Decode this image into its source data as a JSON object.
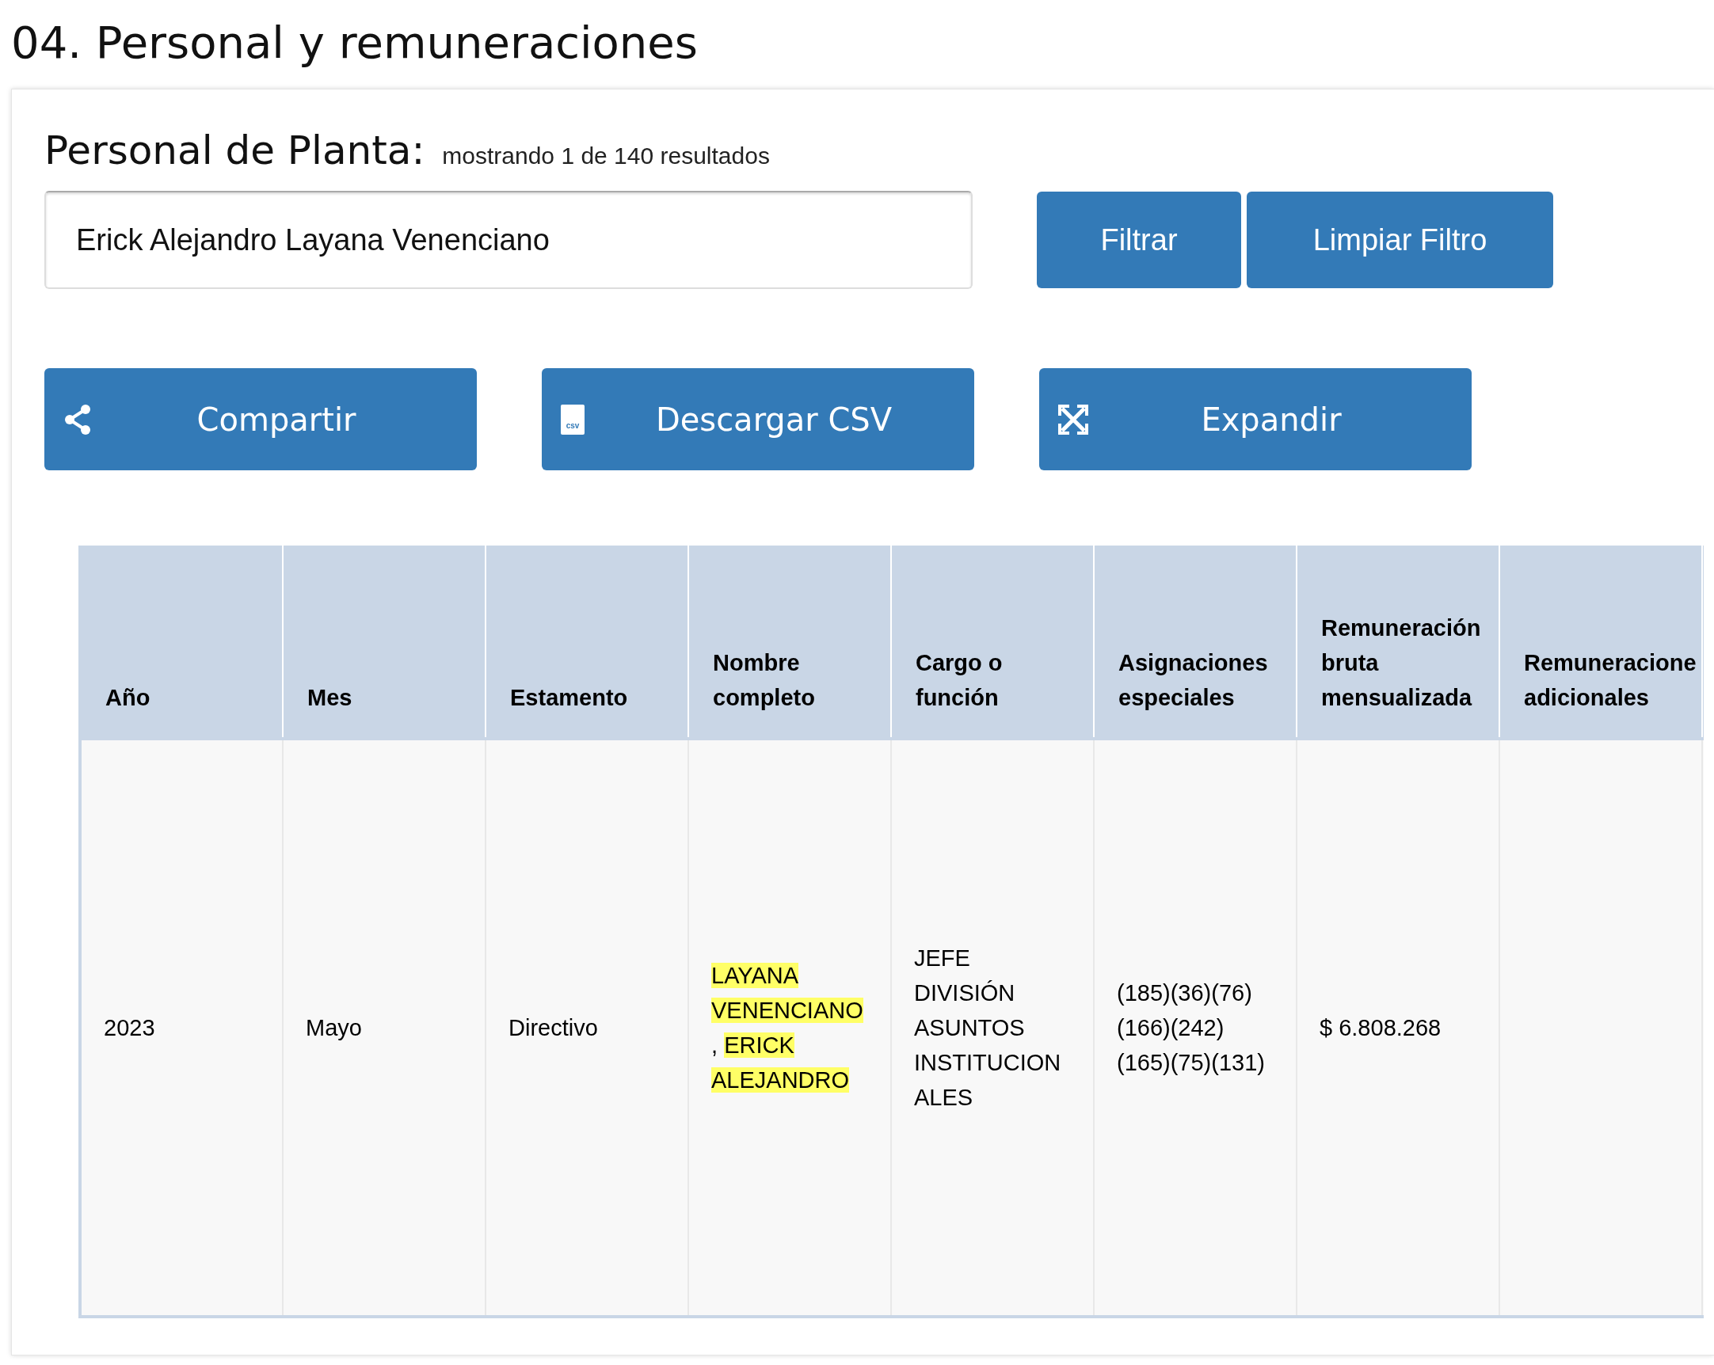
{
  "page_title": "04. Personal y remuneraciones",
  "section": {
    "title": "Personal de Planta:",
    "results": "mostrando 1 de 140 resultados"
  },
  "search": {
    "value": "Erick Alejandro Layana Venenciano"
  },
  "filter_buttons": [
    "Filtrar",
    "Limpiar Filtro"
  ],
  "actions": [
    {
      "kind": "share",
      "label": "Compartir"
    },
    {
      "kind": "csv",
      "label": "Descargar CSV",
      "icon_text": "csv"
    },
    {
      "kind": "expand",
      "label": "Expandir"
    }
  ],
  "table": {
    "columns": [
      "Año",
      "Mes",
      "Estamento",
      "Nombre completo",
      "Cargo o función",
      "Asignaciones especiales",
      "Remuneración bruta mensualizada",
      "Remuneracione adicionales"
    ],
    "rows": [
      {
        "year": "2023",
        "month": "Mayo",
        "estamento": "Directivo",
        "name": [
          {
            "text": "LAYANA VENENCIANO",
            "highlighted": true
          },
          {
            "text": ", ",
            "highlighted": false
          },
          {
            "text": "ERICK ALEJANDRO",
            "highlighted": true
          }
        ],
        "cargo": "JEFE DIVISIÓN ASUNTOS INSTITUCIONALES",
        "asignaciones": "(185)(36)(76)(166)(242)(165)(75)(131)",
        "bruta": "$ 6.808.268"
      }
    ]
  }
}
